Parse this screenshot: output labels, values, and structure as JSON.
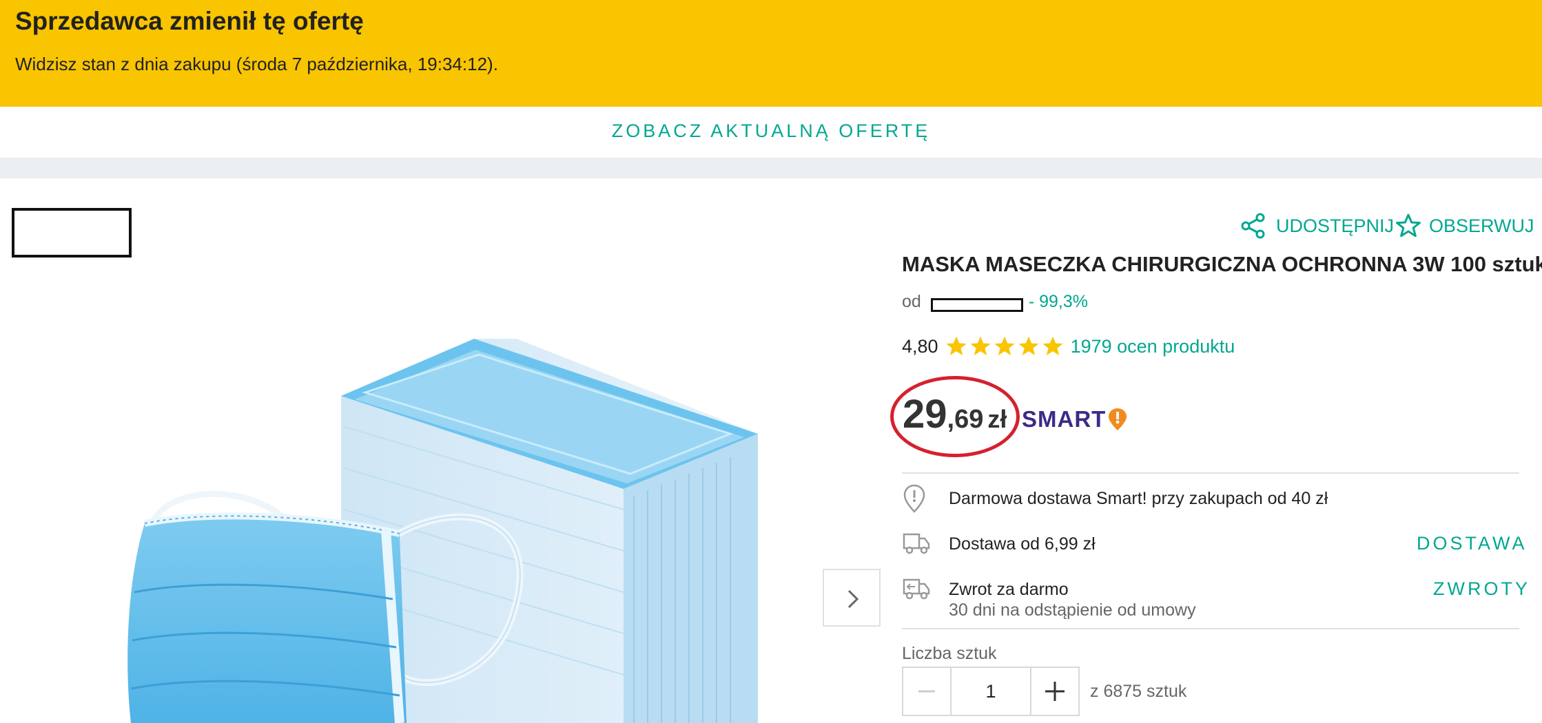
{
  "banner": {
    "title": "Sprzedawca zmienił tę ofertę",
    "subtitle": "Widzisz stan z dnia zakupu (środa 7 października, 19:34:12).",
    "bg_color": "#f9c400"
  },
  "cta": {
    "label": "ZOBACZ AKTUALNĄ OFERTĘ"
  },
  "actions": {
    "share_label": "UDOSTĘPNIJ",
    "watch_label": "OBSERWUJ"
  },
  "product": {
    "title": "MASKA MASECZKA CHIRURGICZNA OCHRONNA 3W 100 sztuk",
    "seller_prefix": "od",
    "seller_rating": "- 99,3%",
    "rating_value": "4,80",
    "rating_stars": 5,
    "rating_count": "1979 ocen produktu",
    "price_int": "29",
    "price_dec": ",69",
    "price_currency": "zł",
    "smart_label": "SMART"
  },
  "delivery": {
    "free_text": "Darmowa dostawa Smart! przy zakupach od 40 zł",
    "cost_text": "Dostawa od 6,99 zł",
    "cost_link": "DOSTAWA",
    "return_text": "Zwrot za darmo",
    "return_sub": "30 dni na odstąpienie od umowy",
    "return_link": "ZWROTY"
  },
  "quantity": {
    "label": "Liczba sztuk",
    "value": "1",
    "available": "z 6875 sztuk"
  },
  "colors": {
    "accent": "#00a790",
    "banner": "#f9c400",
    "highlight_circle": "#d6202e",
    "smart_brand": "#3d2a88",
    "smart_badge": "#f28b1d"
  },
  "icons": [
    "share-icon",
    "star-outline-icon",
    "star-icon",
    "shield-pin-icon",
    "truck-icon",
    "return-truck-icon",
    "chevron-right-icon",
    "minus-icon",
    "plus-icon"
  ]
}
